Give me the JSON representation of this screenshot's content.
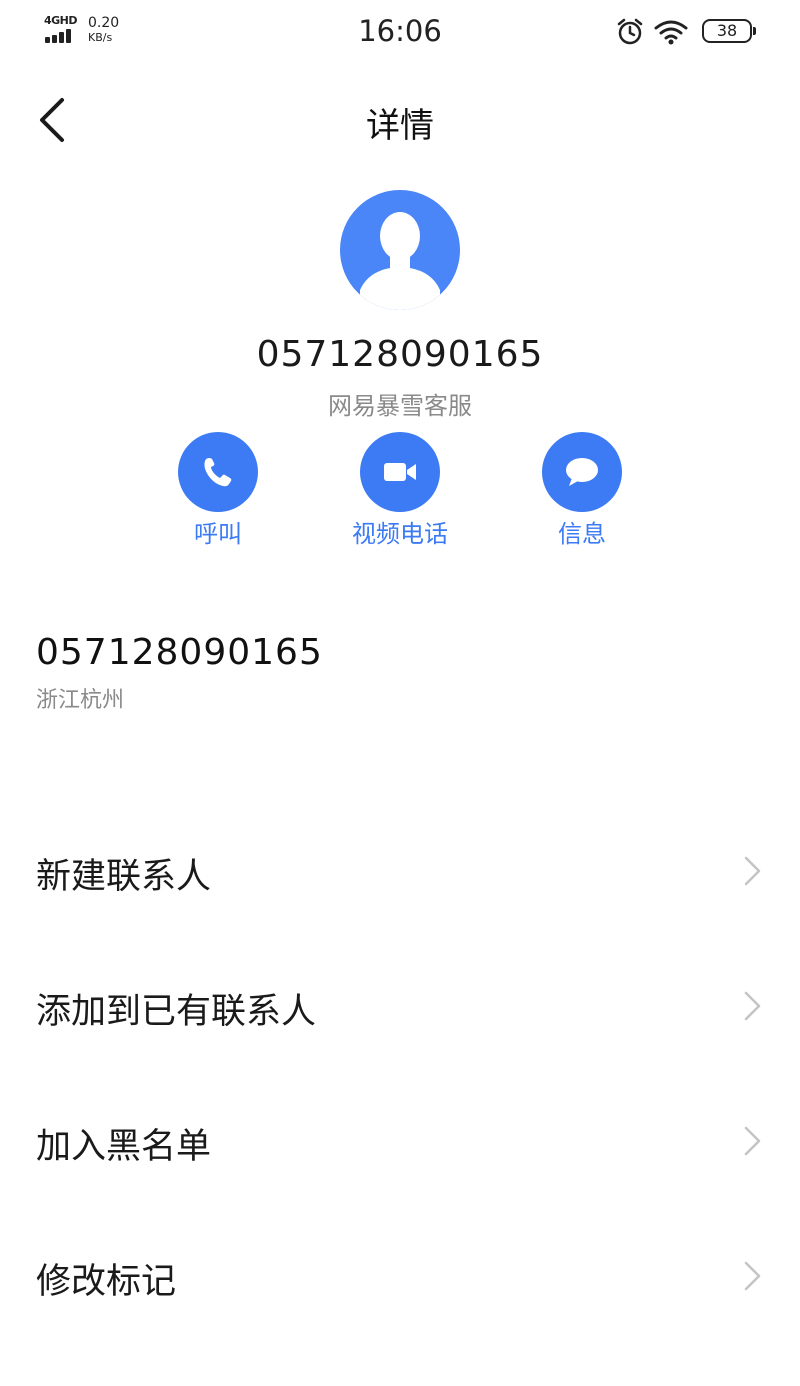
{
  "status_bar": {
    "network": "4GHD",
    "speed_value": "0.20",
    "speed_unit": "KB/s",
    "time": "16:06",
    "battery": "38"
  },
  "header": {
    "title": "详情"
  },
  "contact": {
    "number": "057128090165",
    "label": "网易暴雪客服"
  },
  "actions": [
    {
      "label": "呼叫",
      "icon": "phone-icon"
    },
    {
      "label": "视频电话",
      "icon": "video-camera-icon"
    },
    {
      "label": "信息",
      "icon": "message-bubble-icon"
    }
  ],
  "phone_entry": {
    "number": "057128090165",
    "location": "浙江杭州"
  },
  "menu": [
    {
      "label": "新建联系人"
    },
    {
      "label": "添加到已有联系人"
    },
    {
      "label": "加入黑名单"
    },
    {
      "label": "修改标记"
    }
  ],
  "colors": {
    "accent": "#3d7bf4",
    "avatar_bg": "#4a86f7",
    "secondary_text": "#8a8a8a"
  }
}
